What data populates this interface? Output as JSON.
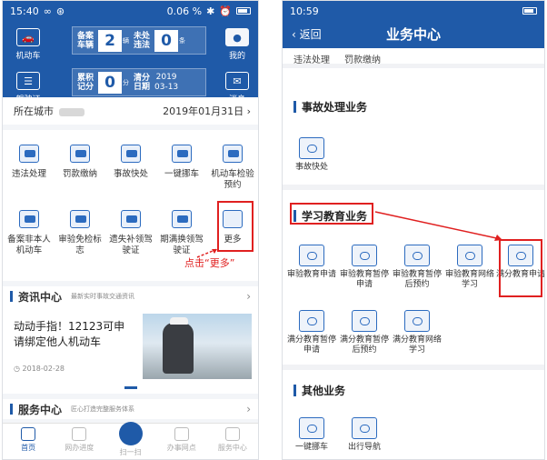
{
  "left": {
    "status": {
      "time": "15:40",
      "signal": "0.06 %"
    },
    "header": {
      "vehicle_label": "机动车",
      "license_label": "驾驶证",
      "mine_label": "我的",
      "message_label": "消息",
      "filed_vehicles_label": "备案车辆",
      "filed_vehicles_value": "2",
      "filed_vehicles_unit": "辆",
      "unhandled_label": "未处违法",
      "unhandled_value": "0",
      "unhandled_unit": "条",
      "points_label": "累积记分",
      "points_value": "0",
      "points_unit": "分",
      "clear_label": "清分日期",
      "clear_year": "2019",
      "clear_date": "03-13"
    },
    "city": {
      "label": "所在城市",
      "date": "2019年01月31日"
    },
    "grid": [
      "违法处理",
      "罚款缴纳",
      "事故快处",
      "一键挪车",
      "机动车检验预约",
      "备案非本人机动车",
      "审验免检标志",
      "遗失补领驾驶证",
      "期满换领驾驶证",
      "更多"
    ],
    "annotation": "点击“更多”",
    "news_header": {
      "title": "资讯中心",
      "subtitle": "最新实时事故交通资讯"
    },
    "news": {
      "title": "动动手指！12123可申请绑定他人机动车",
      "date": "2018-02-28"
    },
    "service_header": {
      "title": "服务中心",
      "subtitle": "匠心打造完整服务体系"
    },
    "tabs": [
      "首页",
      "网办进度",
      "扫一扫",
      "办事网点",
      "服务中心"
    ]
  },
  "right": {
    "status": {
      "time": "10:59"
    },
    "back_label": "返回",
    "title": "业务中心",
    "top_items": [
      "违法处理",
      "罚款缴纳"
    ],
    "accident_section": "事故处理业务",
    "accident_items": [
      "事故快处"
    ],
    "study_section": "学习教育业务",
    "study_items": [
      "审验教育申请",
      "审验教育暂停申请",
      "审验教育暂停后预约",
      "审验教育网络学习",
      "满分教育申请",
      "满分教育暂停申请",
      "满分教育暂停后预约",
      "满分教育网络学习"
    ],
    "other_section": "其他业务",
    "other_items": [
      "一键挪车",
      "出行导航"
    ]
  }
}
